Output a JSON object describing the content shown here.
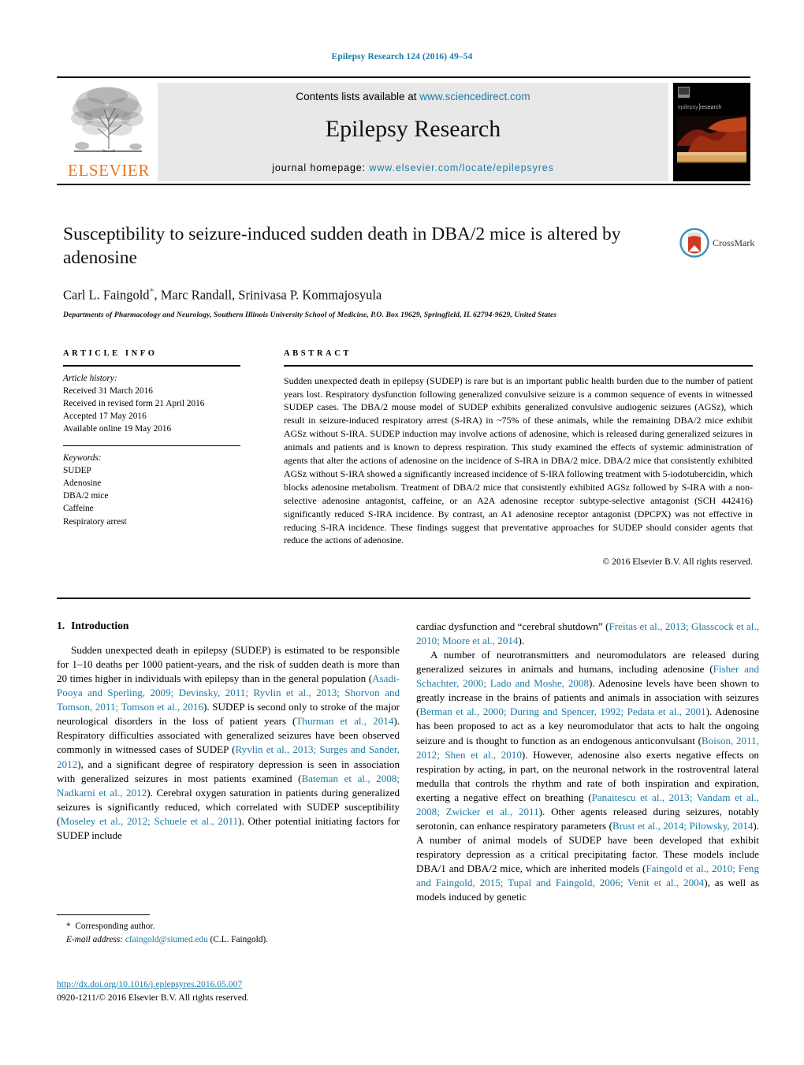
{
  "running_head": "Epilepsy Research 124 (2016) 49–54",
  "masthead": {
    "contents_prefix": "Contents lists available at ",
    "contents_link": "www.sciencedirect.com",
    "journal_name": "Epilepsy Research",
    "homepage_prefix": "journal homepage: ",
    "homepage_link": "www.elsevier.com/locate/epilepsyres",
    "publisher": "ELSEVIER",
    "cover_caption": "epilepsy research"
  },
  "title_block": {
    "title": "Susceptibility to seizure-induced sudden death in DBA/2 mice is altered by adenosine",
    "authors": "Carl L. Faingold",
    "authors_rest": ", Marc Randall, Srinivasa P. Kommajosyula",
    "corresponding_marker": "*",
    "affiliation": "Departments of Pharmacology and Neurology, Southern Illinois University School of Medicine, P.O. Box 19629, Springfield, IL 62794-9629, United States",
    "crossmark_label": "CrossMark"
  },
  "article_info": {
    "heading": "ARTICLE INFO",
    "history_label": "Article history:",
    "history": [
      "Received 31 March 2016",
      "Received in revised form 21 April 2016",
      "Accepted 17 May 2016",
      "Available online 19 May 2016"
    ],
    "keywords_label": "Keywords:",
    "keywords": [
      "SUDEP",
      "Adenosine",
      "DBA/2 mice",
      "Caffeine",
      "Respiratory arrest"
    ]
  },
  "abstract": {
    "heading": "ABSTRACT",
    "text": "Sudden unexpected death in epilepsy (SUDEP) is rare but is an important public health burden due to the number of patient years lost. Respiratory dysfunction following generalized convulsive seizure is a common sequence of events in witnessed SUDEP cases. The DBA/2 mouse model of SUDEP exhibits generalized convulsive audiogenic seizures (AGSz), which result in seizure-induced respiratory arrest (S-IRA) in ~75% of these animals, while the remaining DBA/2 mice exhibit AGSz without S-IRA. SUDEP induction may involve actions of adenosine, which is released during generalized seizures in animals and patients and is known to depress respiration. This study examined the effects of systemic administration of agents that alter the actions of adenosine on the incidence of S-IRA in DBA/2 mice. DBA/2 mice that consistently exhibited AGSz without S-IRA showed a significantly increased incidence of S-IRA following treatment with 5-iodotubercidin, which blocks adenosine metabolism. Treatment of DBA/2 mice that consistently exhibited AGSz followed by S-IRA with a non-selective adenosine antagonist, caffeine, or an A2A adenosine receptor subtype-selective antagonist (SCH 442416) significantly reduced S-IRA incidence. By contrast, an A1 adenosine receptor antagonist (DPCPX) was not effective in reducing S-IRA incidence. These findings suggest that preventative approaches for SUDEP should consider agents that reduce the actions of adenosine.",
    "copyright": "© 2016 Elsevier B.V. All rights reserved."
  },
  "introduction": {
    "number": "1.",
    "heading": "Introduction",
    "left_paragraph_1": "Sudden unexpected death in epilepsy (SUDEP) is estimated to be responsible for 1–10 deaths per 1000 patient-years, and the risk of sudden death is more than 20 times higher in individuals with epilepsy than in the general population (",
    "left_ref_1": "Asadi-Pooya and Sperling, 2009; Devinsky, 2011; Ryvlin et al., 2013; Shorvon and Tomson, 2011; Tomson et al., 2016",
    "left_text_2": "). SUDEP is second only to stroke of the major neurological disorders in the loss of patient years (",
    "left_ref_2": "Thurman et al., 2014",
    "left_text_3": "). Respiratory difficulties associated with generalized seizures have been observed commonly in witnessed cases of SUDEP (",
    "left_ref_3": "Ryvlin et al., 2013; Surges and Sander, 2012",
    "left_text_4": "), and a significant degree of respiratory depression is seen in association with generalized seizures in most patients examined (",
    "left_ref_4": "Bateman et al., 2008; Nadkarni et al., 2012",
    "left_text_5": "). Cerebral oxygen saturation in patients during generalized seizures is significantly reduced, which correlated with SUDEP susceptibility (",
    "left_ref_5": "Moseley et al., 2012; Schuele et al., 2011",
    "left_text_6": "). Other potential initiating factors for SUDEP include",
    "right_text_1": "cardiac dysfunction and “cerebral shutdown” (",
    "right_ref_1": "Freitas et al., 2013; Glasscock et al., 2010; Moore et al., 2014",
    "right_text_2": ").",
    "right_paragraph_2": "A number of neurotransmitters and neuromodulators are released during generalized seizures in animals and humans, including adenosine (",
    "right_ref_2": "Fisher and Schachter, 2000; Lado and Moshe, 2008",
    "right_text_3": "). Adenosine levels have been shown to greatly increase in the brains of patients and animals in association with seizures (",
    "right_ref_3": "Berman et al., 2000; During and Spencer, 1992; Pedata et al., 2001",
    "right_text_4": "). Adenosine has been proposed to act as a key neuromodulator that acts to halt the ongoing seizure and is thought to function as an endogenous anticonvulsant (",
    "right_ref_4": "Boison, 2011, 2012; Shen et al., 2010",
    "right_text_5": "). However, adenosine also exerts negative effects on respiration by acting, in part, on the neuronal network in the rostroventral lateral medulla that controls the rhythm and rate of both inspiration and expiration, exerting a negative effect on breathing (",
    "right_ref_5": "Panaitescu et al., 2013; Vandam et al., 2008; Zwicker et al., 2011",
    "right_text_6": "). Other agents released during seizures, notably serotonin, can enhance respiratory parameters (",
    "right_ref_6": "Brust et al., 2014; Pilowsky, 2014",
    "right_text_7": "). A number of animal models of SUDEP have been developed that exhibit respiratory depression as a critical precipitating factor. These models include DBA/1 and DBA/2 mice, which are inherited models (",
    "right_ref_7": "Faingold et al., 2010; Feng and Faingold, 2015; Tupal and Faingold, 2006; Venit et al., 2004",
    "right_text_8": "), as well as models induced by genetic"
  },
  "footer": {
    "corresponding_marker": "*",
    "corresponding_label": "Corresponding author.",
    "email_label": "E-mail address:",
    "email": "cfaingold@siumed.edu",
    "email_owner": "(C.L. Faingold).",
    "doi": "http://dx.doi.org/10.1016/j.eplepsyres.2016.05.007",
    "issn_line": "0920-1211/© 2016 Elsevier B.V. All rights reserved."
  },
  "colors": {
    "link": "#1b7ba7",
    "elsevier_orange": "#e87722",
    "masthead_bg": "#e8e8e8"
  }
}
